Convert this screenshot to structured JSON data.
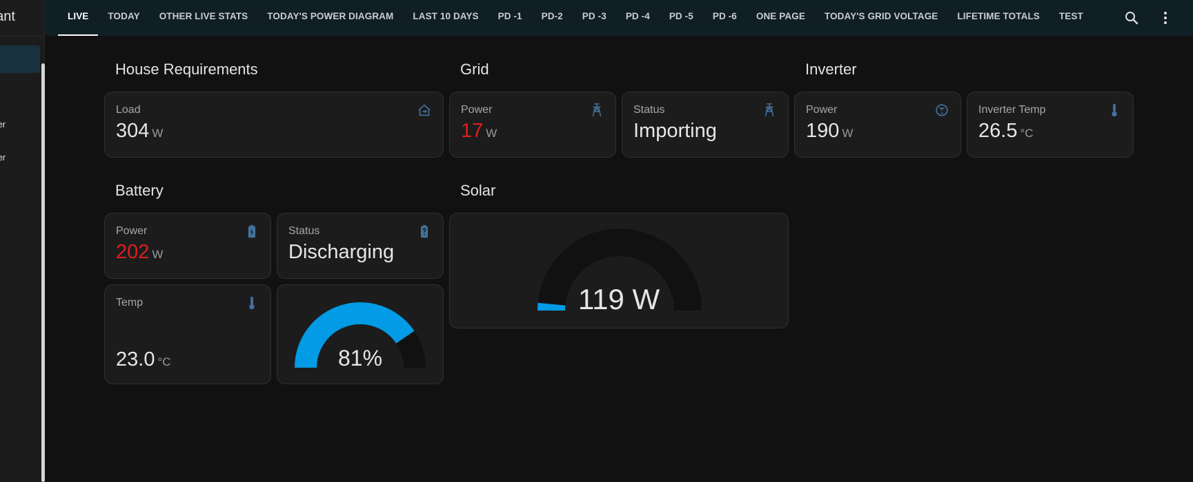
{
  "sidebar": {
    "brand": "ant",
    "items": [
      "er",
      "er"
    ]
  },
  "tabs": [
    {
      "label": "LIVE",
      "active": true
    },
    {
      "label": "TODAY"
    },
    {
      "label": "OTHER LIVE STATS"
    },
    {
      "label": "TODAY'S POWER DIAGRAM"
    },
    {
      "label": "LAST 10 DAYS"
    },
    {
      "label": "PD -1"
    },
    {
      "label": "PD-2"
    },
    {
      "label": "PD -3"
    },
    {
      "label": "PD -4"
    },
    {
      "label": "PD -5"
    },
    {
      "label": "PD -6"
    },
    {
      "label": "ONE PAGE"
    },
    {
      "label": "TODAY'S GRID VOLTAGE"
    },
    {
      "label": "LIFETIME TOTALS"
    },
    {
      "label": "TEST"
    }
  ],
  "toolbar_icons": [
    "search-icon",
    "more-vertical-icon"
  ],
  "house": {
    "title": "House Requirements",
    "load": {
      "label": "Load",
      "value": "304",
      "unit": "W",
      "icon": "home-export-icon"
    }
  },
  "grid": {
    "title": "Grid",
    "power": {
      "label": "Power",
      "value": "17",
      "unit": "W",
      "icon": "transmission-tower-icon"
    },
    "status": {
      "label": "Status",
      "value": "Importing",
      "icon": "transmission-tower-icon"
    }
  },
  "inverter": {
    "title": "Inverter",
    "power": {
      "label": "Power",
      "value": "190",
      "unit": "W",
      "icon": "meter-icon"
    },
    "temp": {
      "label": "Inverter Temp",
      "value": "26.5",
      "unit": "°C",
      "icon": "thermometer-icon"
    }
  },
  "battery": {
    "title": "Battery",
    "power": {
      "label": "Power",
      "value": "202",
      "unit": "W",
      "icon": "battery-charging-icon"
    },
    "status": {
      "label": "Status",
      "value": "Discharging",
      "icon": "battery-unknown-icon"
    },
    "temp": {
      "label": "Temp",
      "value": "23.0",
      "unit": "°C",
      "icon": "thermometer-icon"
    },
    "soc": {
      "value": "81%",
      "fraction": 0.81
    }
  },
  "solar": {
    "title": "Solar",
    "gauge": {
      "value": "119 W",
      "fraction": 0.03
    }
  },
  "colors": {
    "accent": "#039be5",
    "icon": "#44739e",
    "negative": "#e01d1d",
    "gauge_track": "#111111"
  }
}
